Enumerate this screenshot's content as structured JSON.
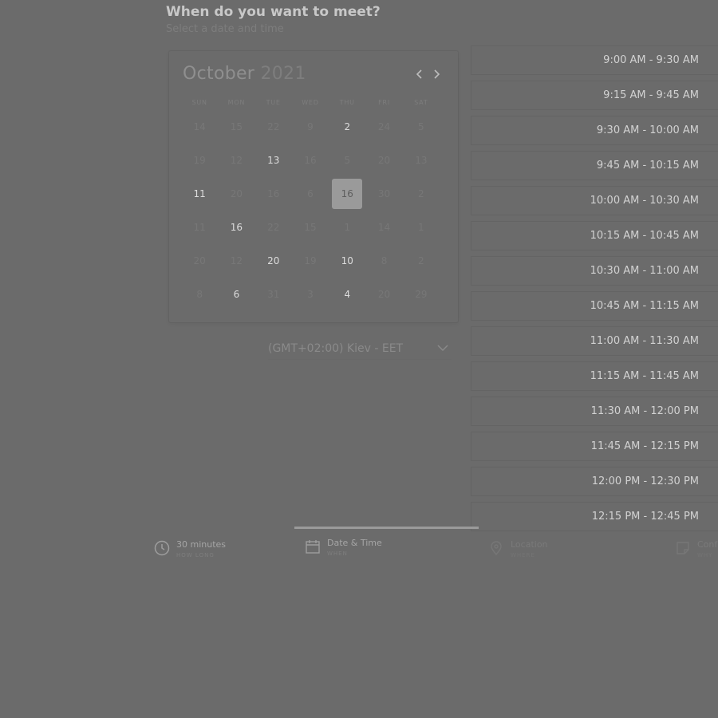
{
  "header": {
    "title": "When do you want to meet?",
    "subtitle": "Select a date and time"
  },
  "calendar": {
    "month": "October",
    "year": "2021",
    "prev_icon": "chevron-left-icon",
    "next_icon": "chevron-right-icon",
    "weekdays": [
      "SUN",
      "MON",
      "TUE",
      "WED",
      "THU",
      "FRI",
      "SAT"
    ],
    "weeks": [
      [
        "14",
        "15",
        "22",
        "9",
        "2",
        "24",
        "5"
      ],
      [
        "19",
        "12",
        "13",
        "16",
        "5",
        "20",
        "13"
      ],
      [
        "11",
        "20",
        "16",
        "6",
        "16",
        "30",
        "2"
      ],
      [
        "11",
        "16",
        "22",
        "15",
        "1",
        "14",
        "1"
      ],
      [
        "20",
        "12",
        "20",
        "19",
        "10",
        "8",
        "2"
      ],
      [
        "8",
        "6",
        "31",
        "3",
        "4",
        "20",
        "29"
      ]
    ],
    "available": [
      [
        0,
        4
      ],
      [
        1,
        2
      ],
      [
        2,
        0
      ],
      [
        3,
        1
      ],
      [
        4,
        2
      ],
      [
        4,
        4
      ],
      [
        5,
        1
      ],
      [
        5,
        4
      ]
    ],
    "selected": [
      2,
      4
    ]
  },
  "timezone": {
    "value": "(GMT+02:00) Kiev - EET",
    "icon": "chevron-down-icon"
  },
  "time_slots": [
    "9:00 AM - 9:30 AM",
    "9:15 AM - 9:45 AM",
    "9:30 AM - 10:00 AM",
    "9:45 AM - 10:15 AM",
    "10:00 AM - 10:30 AM",
    "10:15 AM - 10:45 AM",
    "10:30 AM - 11:00 AM",
    "10:45 AM - 11:15 AM",
    "11:00 AM - 11:30 AM",
    "11:15 AM - 11:45 AM",
    "11:30 AM - 12:00 PM",
    "11:45 AM - 12:15 PM",
    "12:00 PM - 12:30 PM",
    "12:15 PM - 12:45 PM"
  ],
  "steps": [
    {
      "label": "30 minutes",
      "sub": "HOW LONG",
      "icon": "clock-icon"
    },
    {
      "label": "Date & Time",
      "sub": "WHEN",
      "icon": "calendar-icon"
    },
    {
      "label": "Location",
      "sub": "WHERE",
      "icon": "location-pin-icon"
    },
    {
      "label": "Conf",
      "sub": "WHY",
      "icon": "note-icon"
    }
  ]
}
